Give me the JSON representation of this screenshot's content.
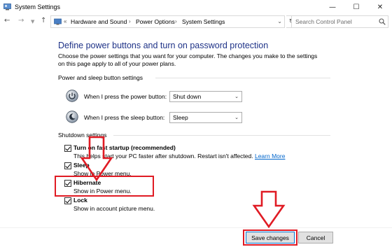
{
  "window": {
    "title": "System Settings",
    "minimize_glyph": "—",
    "maximize_glyph": "☐",
    "close_glyph": "✕"
  },
  "addressbar": {
    "prefix": "«",
    "crumbs": [
      "Hardware and Sound",
      "Power Options",
      "System Settings"
    ],
    "separator": "›",
    "dropdown_glyph": "⌄",
    "refresh_glyph": "↻"
  },
  "search": {
    "placeholder": "Search Control Panel"
  },
  "page": {
    "heading": "Define power buttons and turn on password protection",
    "intro": "Choose the power settings that you want for your computer. The changes you make to the settings on this page apply to all of your power plans."
  },
  "power_section": {
    "title": "Power and sleep button settings",
    "rows": [
      {
        "label": "When I press the power button:",
        "value": "Shut down",
        "icon": "power-button-icon"
      },
      {
        "label": "When I press the sleep button:",
        "value": "Sleep",
        "icon": "sleep-button-icon"
      }
    ]
  },
  "shutdown_section": {
    "title": "Shutdown settings",
    "items": [
      {
        "label": "Turn on fast startup (recommended)",
        "desc": "This helps start your PC faster after shutdown. Restart isn't affected.",
        "link": "Learn More",
        "checked": true
      },
      {
        "label": "Sleep",
        "desc": "Show in Power menu.",
        "checked": true
      },
      {
        "label": "Hibernate",
        "desc": "Show in Power menu.",
        "checked": true
      },
      {
        "label": "Lock",
        "desc": "Show in account picture menu.",
        "checked": true
      }
    ]
  },
  "footer": {
    "save_label": "Save changes",
    "cancel_label": "Cancel"
  },
  "colors": {
    "heading": "#1e3287",
    "link": "#0066cc",
    "annotation": "#e01b24"
  }
}
